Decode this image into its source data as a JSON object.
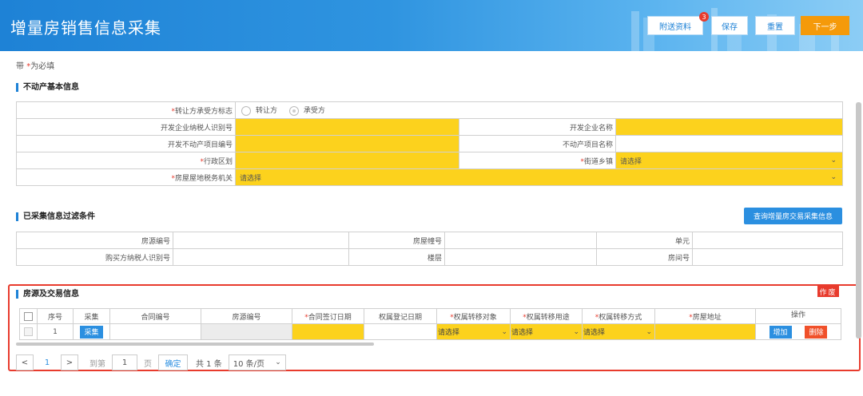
{
  "header": {
    "title": "增量房销售信息采集",
    "buttons": {
      "attach": "附送资料",
      "save": "保存",
      "reset": "重置",
      "next": "下一步"
    },
    "attach_badge": "3"
  },
  "required_note": {
    "prefix": "带 ",
    "star": "*",
    "suffix": "为必填"
  },
  "section_basic": {
    "title": "不动产基本信息",
    "transfer_flag_label": "转让方承受方标志",
    "radio_transferor": "转让方",
    "radio_transferee": "承受方",
    "dev_taxid_label": "开发企业纳税人识别号",
    "dev_name_label": "开发企业名称",
    "project_no_label": "开发不动产项目编号",
    "project_name_label": "不动产项目名称",
    "district_label": "行政区划",
    "town_label": "街道乡镇",
    "town_value": "请选择",
    "tax_office_label": "房屋屋地税务机关",
    "tax_office_value": "请选择"
  },
  "section_filter": {
    "title": "已采集信息过滤条件",
    "query_button": "查询增量房交易采集信息",
    "house_no_label": "房源编号",
    "building_no_label": "房屋幢号",
    "unit_label": "单元",
    "buyer_taxid_label": "购买方纳税人识别号",
    "floor_label": "楼层",
    "room_label": "房间号"
  },
  "section_trade": {
    "title": "房源及交易信息",
    "void_tag": "作废",
    "columns": {
      "seq": "序号",
      "collect": "采集",
      "contract_no": "合同编号",
      "house_no": "房源编号",
      "sign_date": "合同签订日期",
      "reg_date": "权属登记日期",
      "transfer_obj": "权属转移对象",
      "transfer_use": "权属转移用途",
      "transfer_mode": "权属转移方式",
      "address": "房屋地址",
      "ops": "操作"
    },
    "row": {
      "seq": "1",
      "collect_btn": "采集",
      "transfer_obj": "请选择",
      "transfer_use": "请选择",
      "transfer_mode": "请选择",
      "add_btn": "增加",
      "delete_btn": "删除"
    }
  },
  "pager": {
    "prev": "<",
    "current": "1",
    "next": ">",
    "goto_label": "到第",
    "goto_value": "1",
    "page_label": "页",
    "confirm": "确定",
    "total": "共 1 条",
    "page_size": "10 条/页"
  },
  "colors": {
    "accent": "#1e82d6",
    "required_yellow": "#fcd21d",
    "danger": "#e83b2d",
    "next_orange": "#f59a0a"
  }
}
